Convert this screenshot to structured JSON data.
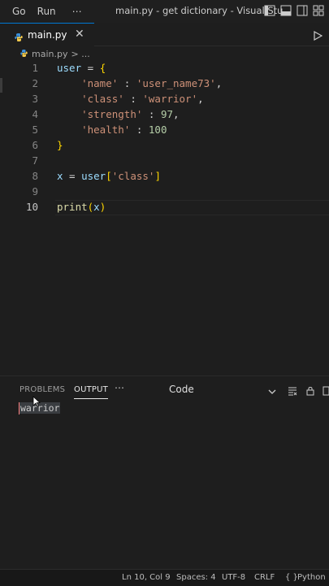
{
  "menu": {
    "go": "Go",
    "run": "Run",
    "more": "⋯"
  },
  "window": {
    "title": "main.py - get dictionary - Visual Stu..."
  },
  "tab": {
    "label": "main.py",
    "close": "✕"
  },
  "breadcrumb": {
    "file": "main.py",
    "sep": "> ..."
  },
  "editor": {
    "line_numbers": [
      "1",
      "2",
      "3",
      "4",
      "5",
      "6",
      "7",
      "8",
      "9",
      "10"
    ],
    "current_line": 10,
    "l1": {
      "var": "user",
      "op": " = ",
      "brace": "{"
    },
    "l2": {
      "key": "'name'",
      "colon": " : ",
      "val": "'user_name73'",
      "comma": ","
    },
    "l3": {
      "key": "'class'",
      "colon": " : ",
      "val": "'warrior'",
      "comma": ","
    },
    "l4": {
      "key": "'strength'",
      "colon": " : ",
      "val": "97",
      "comma": ","
    },
    "l5": {
      "key": "'health'",
      "colon": " : ",
      "val": "100"
    },
    "l6": {
      "brace": "}"
    },
    "l8": {
      "var": "x",
      "op": " = ",
      "obj": "user",
      "bo": "[",
      "key": "'class'",
      "bc": "]"
    },
    "l10": {
      "func": "print",
      "po": "(",
      "arg": "x",
      "pc": ")"
    }
  },
  "panel": {
    "tabs": {
      "problems": "PROBLEMS",
      "output": "OUTPUT"
    },
    "more": "⋯",
    "channel": "Code",
    "output_text": "warrior"
  },
  "status": {
    "position": "Ln 10, Col 9",
    "spaces": "Spaces: 4",
    "encoding": "UTF-8",
    "eol": "CRLF",
    "language": "Python"
  },
  "colors": {
    "accent": "#0078d4",
    "background": "#1e1e1e"
  }
}
